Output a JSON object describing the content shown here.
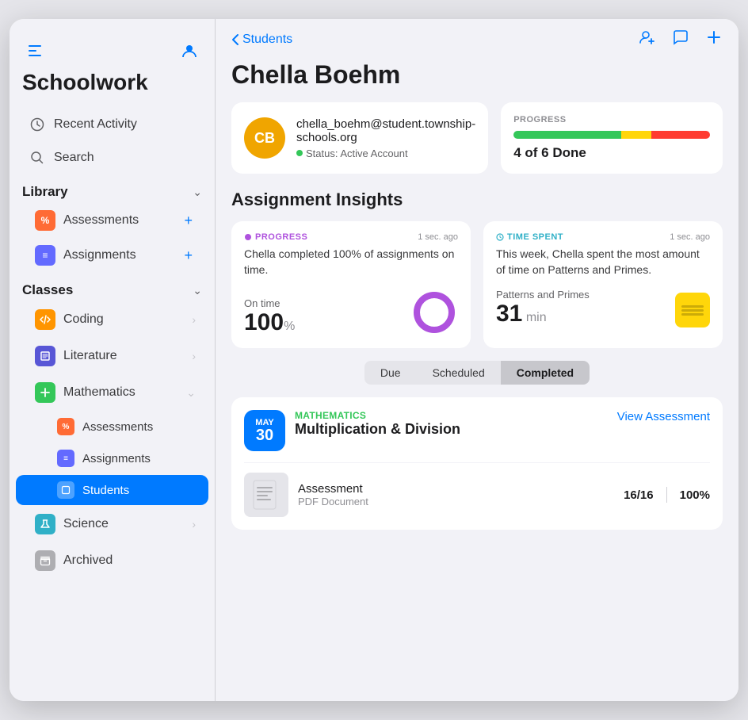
{
  "app": {
    "title": "Schoolwork"
  },
  "sidebar": {
    "toggle_icon": "⊞",
    "profile_icon": "👤",
    "nav_items": [
      {
        "id": "recent-activity",
        "icon": "🕐",
        "label": "Recent Activity"
      },
      {
        "id": "search",
        "icon": "🔍",
        "label": "Search"
      }
    ],
    "library": {
      "title": "Library",
      "items": [
        {
          "id": "lib-assessments",
          "icon": "%",
          "label": "Assessments",
          "icon_class": "icon-assessments"
        },
        {
          "id": "lib-assignments",
          "icon": "≡",
          "label": "Assignments",
          "icon_class": "icon-assignments"
        }
      ]
    },
    "classes": {
      "title": "Classes",
      "items": [
        {
          "id": "coding",
          "icon": "■",
          "label": "Coding",
          "icon_class": "icon-coding",
          "has_chevron": true,
          "expanded": false
        },
        {
          "id": "literature",
          "icon": "■",
          "label": "Literature",
          "icon_class": "icon-literature",
          "has_chevron": true,
          "expanded": false
        },
        {
          "id": "mathematics",
          "icon": "■",
          "label": "Mathematics",
          "icon_class": "icon-mathematics",
          "has_chevron": true,
          "expanded": true
        },
        {
          "id": "science",
          "icon": "■",
          "label": "Science",
          "icon_class": "icon-science",
          "has_chevron": true,
          "expanded": false
        }
      ],
      "mathematics_sub": [
        {
          "id": "math-assessments",
          "label": "Assessments",
          "icon_class": "icon-assessments"
        },
        {
          "id": "math-assignments",
          "label": "Assignments",
          "icon_class": "icon-assignments"
        },
        {
          "id": "math-students",
          "label": "Students",
          "icon_class": "icon-assignments",
          "active": true
        }
      ],
      "archived": {
        "id": "archived",
        "label": "Archived",
        "icon_class": "icon-archived"
      }
    }
  },
  "main": {
    "back_label": "Students",
    "student_name": "Chella Boehm",
    "student_email": "chella_boehm@student.township-schools.org",
    "student_status": "Status: Active Account",
    "student_initials": "CB",
    "progress": {
      "label": "PROGRESS",
      "green_pct": 55,
      "yellow_pct": 15,
      "red_pct": 30,
      "done_text": "4 of 6 Done"
    },
    "insights_title": "Assignment Insights",
    "progress_card": {
      "tag": "PROGRESS",
      "time": "1 sec. ago",
      "desc": "Chella completed 100% of assignments on time.",
      "metric_label": "On time",
      "metric_value": "100",
      "metric_unit": "%",
      "donut_pct": 100
    },
    "time_card": {
      "tag": "TIME SPENT",
      "time": "1 sec. ago",
      "desc": "This week, Chella spent the most amount of time on Patterns and Primes.",
      "subject": "Patterns and Primes",
      "metric_value": "31",
      "metric_unit": "min"
    },
    "tabs": [
      {
        "id": "due",
        "label": "Due",
        "active": false
      },
      {
        "id": "scheduled",
        "label": "Scheduled",
        "active": false
      },
      {
        "id": "completed",
        "label": "Completed",
        "active": true
      }
    ],
    "assignment": {
      "month": "MAY",
      "day": "30",
      "class": "MATHEMATICS",
      "name": "Multiplication & Division",
      "view_btn": "View Assessment",
      "document_name": "Assessment",
      "document_type": "PDF Document",
      "score": "16/16",
      "score_pct": "100%"
    }
  }
}
